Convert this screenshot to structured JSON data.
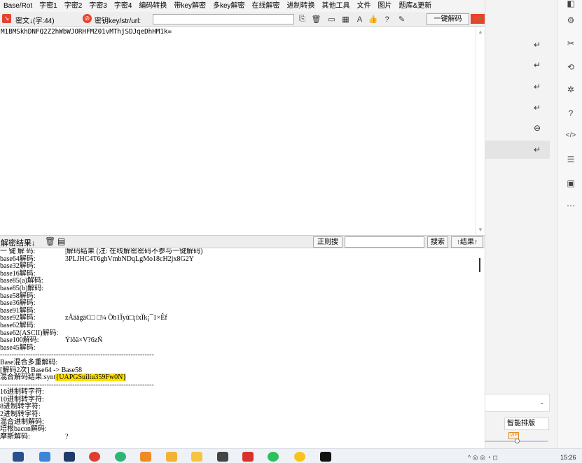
{
  "menu": [
    "Base/Rot",
    "字密1",
    "字密2",
    "字密3",
    "字密4",
    "编码转换",
    "带key解密",
    "多key解密",
    "在线解密",
    "进制转换",
    "其他工具",
    "文件",
    "图片",
    "题库&更新"
  ],
  "toolbar": {
    "cipher_label": "密文↓(字:44)",
    "key_label": "密钥key/str/url:",
    "key_value": "",
    "one_click_button": "一键解码",
    "arrow_badge": "=>"
  },
  "input_text": "M1BMSkhDNFQ2Z2hWbWJORHFMZ01vMThjSDJqeDhHM1k=",
  "result_bar": {
    "label": "解密结果↓",
    "regex_button": "正则搜",
    "search_value": "",
    "search_button": "搜索",
    "results_button": "↑结果↑"
  },
  "output_lines": [
    {
      "label": "一 键 解 码:",
      "value": "|解码结果 (注: 在线解密密码不参与一键解码)"
    },
    {
      "label": "base64解码:",
      "value": "3PLJHC4T6ghVmbNDqLgMo18cH2jx8G2Y"
    },
    {
      "label": "base32解码:",
      "value": ""
    },
    {
      "label": "base16解码:",
      "value": ""
    },
    {
      "label": "base85(a)解码:",
      "value": ""
    },
    {
      "label": "base85(b)解码:",
      "value": ""
    },
    {
      "label": "base58解码:",
      "value": ""
    },
    {
      "label": "base36解码:",
      "value": ""
    },
    {
      "label": "base91解码:",
      "value": ""
    },
    {
      "label": "base92解码:",
      "value": "zÅäägäC□ □¼ Öb1Ïyû□¡ïxÏk¡¯1×Êf"
    },
    {
      "label": "base62解码:",
      "value": ""
    },
    {
      "label": "base62(ASCII)解码:",
      "value": ""
    },
    {
      "label": "base100解码:",
      "value": "Ýlôä×V?6zÑ"
    },
    {
      "label": "base45解码:",
      "value": ""
    },
    {
      "label": "------------------------------------------------------------------",
      "value": ""
    },
    {
      "label": "Base混合多重解码:",
      "value": ""
    },
    {
      "label": "[解码2次] Base64 -> Base58",
      "value": ""
    },
    {
      "label": "混合解码结果:synt",
      "value": "{UAPGSuiliu359Fw0N}",
      "highlight": true
    },
    {
      "label": "------------------------------------------------------------------",
      "value": ""
    },
    {
      "label": "16进制转字符:",
      "value": ""
    },
    {
      "label": "10进制转字符:",
      "value": ""
    },
    {
      "label": "8进制转字符:",
      "value": ""
    },
    {
      "label": "2进制转字符:",
      "value": ""
    },
    {
      "label": "混合进制解码:",
      "value": ""
    },
    {
      "label": "培根bacon解码:",
      "value": ""
    },
    {
      "label": "摩斯解码:",
      "value": "?"
    }
  ],
  "right_panel": {
    "layout_button": "智能排版",
    "vip_badge": "VIP",
    "plus": "+"
  },
  "clock": "15:26",
  "colors": {
    "accent_red": "#e8412c",
    "highlight": "#ffe100",
    "one_click_bg": "#f7f7f7",
    "badge_green": "#22c12a"
  }
}
